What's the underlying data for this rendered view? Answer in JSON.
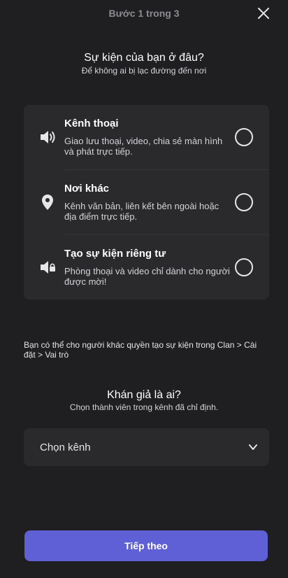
{
  "header": {
    "step_label": "Bước 1 trong 3",
    "close_icon": "close-icon"
  },
  "location": {
    "title": "Sự kiện của bạn ở đâu?",
    "subtitle": "Để không ai bị lạc đường đến nơi",
    "options": [
      {
        "icon": "speaker-icon",
        "title": "Kênh thoại",
        "description": "Giao lưu thoại, video, chia sẻ màn hình và phát trực tiếp.",
        "selected": false
      },
      {
        "icon": "location-pin-icon",
        "title": "Nơi khác",
        "description": "Kênh văn bản, liên kết bên ngoài hoặc địa điểm trực tiếp.",
        "selected": false
      },
      {
        "icon": "private-speaker-icon",
        "title": "Tạo sự kiện riêng tư",
        "description": "Phòng thoại và video chỉ dành cho người được mời!",
        "selected": false
      }
    ]
  },
  "permission_note": "Bạn có thể cho người khác quyền tạo sự kiện trong Clan > Cài đặt > Vai trò",
  "audience": {
    "title": "Khán giả là ai?",
    "subtitle": "Chọn thành viên trong kênh đã chỉ định.",
    "select_label": "Chọn kênh"
  },
  "footer": {
    "next_label": "Tiếp theo"
  },
  "colors": {
    "background": "#1f1f22",
    "card": "#2a2a2d",
    "accent": "#5f5fd6"
  }
}
